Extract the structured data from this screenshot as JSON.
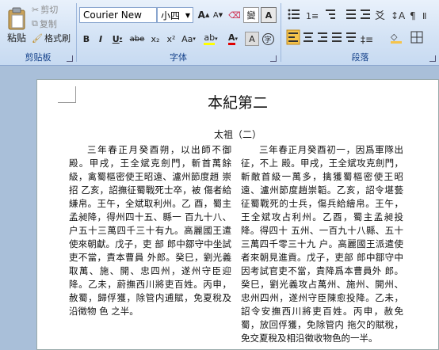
{
  "ribbon": {
    "clipboard": {
      "paste_label": "粘贴",
      "cut_label": "剪切",
      "copy_label": "复制",
      "format_painter_label": "格式刷",
      "group_label": "剪贴板"
    },
    "font": {
      "font_name": "Courier New",
      "font_size": "小四",
      "group_label": "字体",
      "wen_label": "變",
      "a_label": "A",
      "bold": "B",
      "italic": "I",
      "underline": "U",
      "strike": "abe",
      "sub": "x₂",
      "sup": "x²",
      "change_case": "Aa",
      "clear_format": "A",
      "grow": "A",
      "shrink": "A"
    },
    "paragraph": {
      "group_label": "段落"
    }
  },
  "document": {
    "title": "本紀第二",
    "subtitle": "太祖（二）",
    "left_text": "三年春正月癸酉朔，以出師不御殿。甲戌，王全斌克劍門，斬首萬餘 級，禽蜀樞密使王昭遠、瀘州節度趙 崇招 乙亥，詔撫征蜀戰死士卒，被 傷者給縑帛。王午，全斌取利州。乙 酉，蜀主孟昶降，得州四十五、縣一 百九十八、户五十三萬四千三十有九。高麗國王遣使來朝獻。戊子，吏 部 郎中鄒守中坐試吏不當，責本曹員 外郎。癸巳，劉光義取萬、施、開、忠四州，遂州守臣迎降。乙未，蔚撫西川將吏百姓。丙申，赦蜀，歸俘獲，除管内逋賦，免夏稅及沿徵物 色 之半。",
    "right_text": "三年春正月癸酉初一，因爲軍隊出征，不上 殿。甲戌，王全斌攻克劍門，斬敵首級一萬多，擒獲蜀樞密使王昭遠、瀘州節度趙崇韜。乙亥，詔令堪藝征蜀戰死的士兵，傷兵給繪帛。王午，王全斌攻占利州。乙酉，蜀主孟昶投降。得四十 五州、一百九十八縣、五十三萬四千零三十九 户。高麗國王派遣使者來朝見進貢。戊子，吏部 郎中鄒守中因考試官吏不當，責降爲本曹員外 郎。癸巳，劉光義攻占萬州、施州、開州、忠州四州，遂州守臣陳愈投降。乙未，詔令安撫西川將吏百姓。丙申，赦免蜀，放回俘獲，免除管内 拖欠的賦稅，免交夏稅及相沿徵收物色的一半。"
  }
}
